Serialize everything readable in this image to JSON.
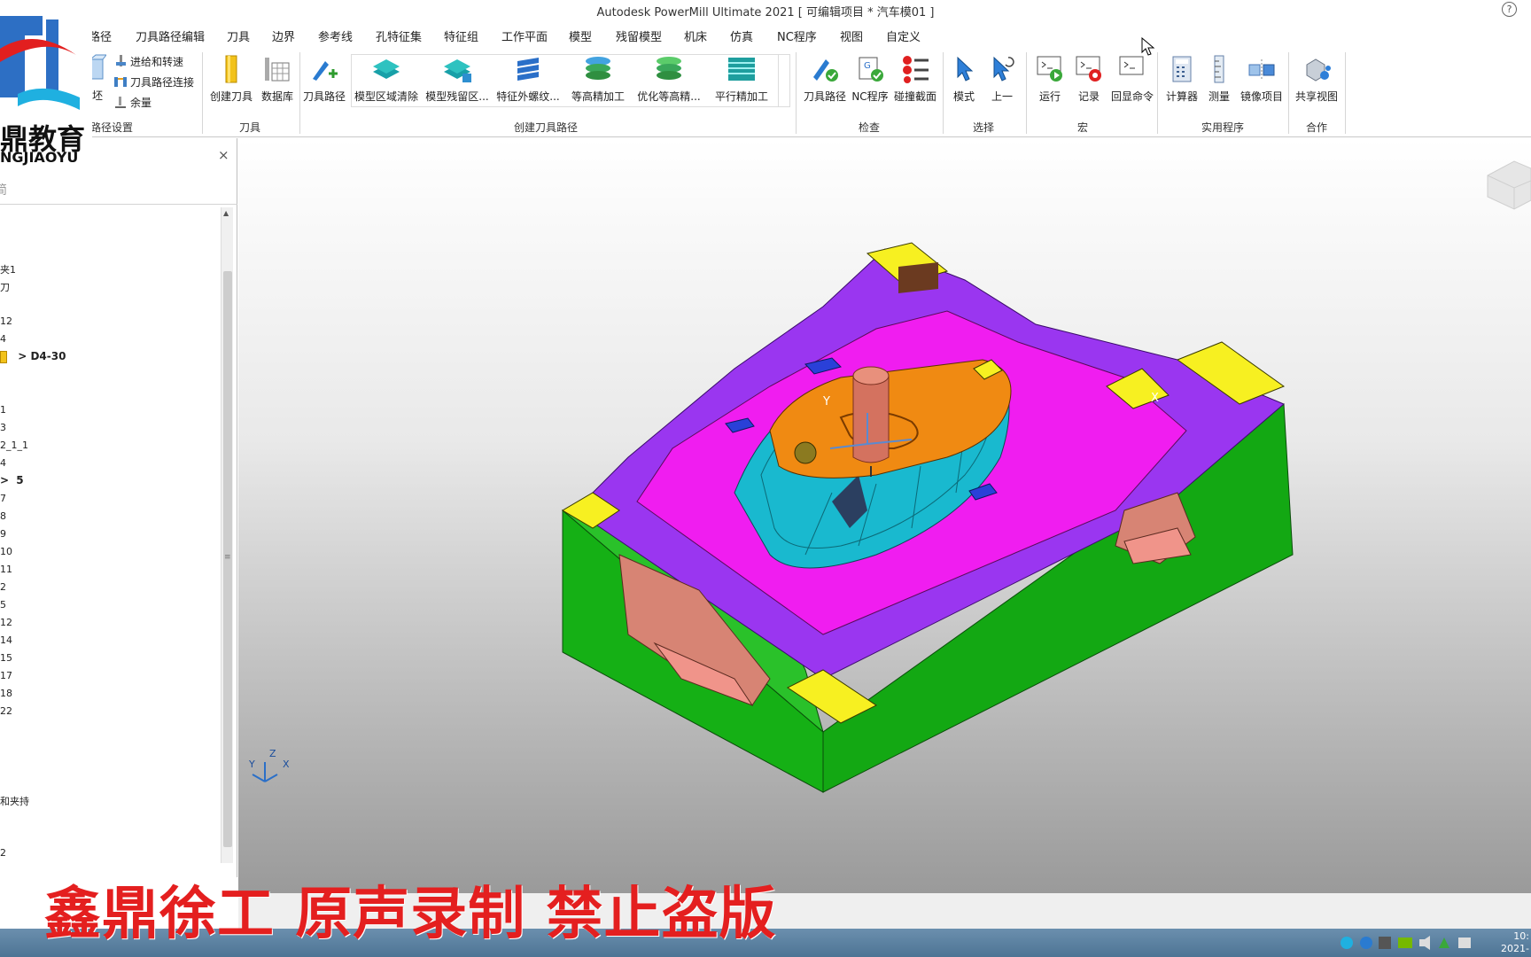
{
  "window": {
    "title": "Autodesk PowerMill Ultimate 2021    [ 可编辑项目 * 汽车模01 ]",
    "help": "?"
  },
  "menu": {
    "tabs": [
      "路径",
      "刀具路径编辑",
      "刀具",
      "边界",
      "参考线",
      "孔特征集",
      "特征组",
      "工作平面",
      "模型",
      "残留模型",
      "机床",
      "仿真",
      "NC程序",
      "视图",
      "自定义"
    ]
  },
  "ribbon": {
    "toolpath_setup": {
      "block_label": "坯",
      "items": [
        "进给和转速",
        "刀具路径连接",
        "余量"
      ],
      "group": "路径设置"
    },
    "tool": {
      "create_tool": "创建刀具",
      "database": "数据库",
      "group": "刀具"
    },
    "create_toolpath": {
      "items": [
        "刀具路径",
        "模型区域清除",
        "模型残留区...",
        "特征外螺纹...",
        "等高精加工",
        "优化等高精...",
        "平行精加工"
      ],
      "group": "创建刀具路径"
    },
    "verify": {
      "items": [
        "刀具路径",
        "NC程序",
        "碰撞截面"
      ],
      "group": "检查"
    },
    "select": {
      "items": [
        "模式",
        "上一"
      ],
      "group": "选择"
    },
    "macro": {
      "items": [
        "运行",
        "记录",
        "回显命令"
      ],
      "group": "宏"
    },
    "utilities": {
      "items": [
        "计算器",
        "测量",
        "镜像项目"
      ],
      "group": "实用程序"
    },
    "collab": {
      "items": [
        "共享视图"
      ],
      "group": "合作"
    }
  },
  "logo": {
    "text": "鼎教育",
    "sub": "NGJIAOYU"
  },
  "explorer": {
    "close": "×",
    "tab_char": "简",
    "rows": [
      "夹1",
      "刀",
      "12",
      "4",
      "D4-30",
      "1",
      "3",
      "2_1_1",
      "4",
      "5",
      "7",
      "8",
      "9",
      "10",
      "11",
      "2",
      "5",
      "12",
      "14",
      "15",
      "17",
      "18",
      "22",
      "和夹持",
      "2"
    ]
  },
  "viewport": {
    "axis_x": "X",
    "axis_y": "Y",
    "triad_x": "X",
    "triad_y": "Y",
    "triad_z": "Z"
  },
  "watermark": "鑫鼎徐工 原声录制 禁止盗版",
  "taskbar": {
    "time": "10:",
    "date": "2021-"
  },
  "colors": {
    "green": "#15b015",
    "magenta": "#f01df0",
    "purple": "#9a36f0",
    "yellow": "#f7f021",
    "cyan": "#19b9cf",
    "orange": "#f08a12",
    "salmon": "#d78474",
    "tool": "#d4725f"
  }
}
